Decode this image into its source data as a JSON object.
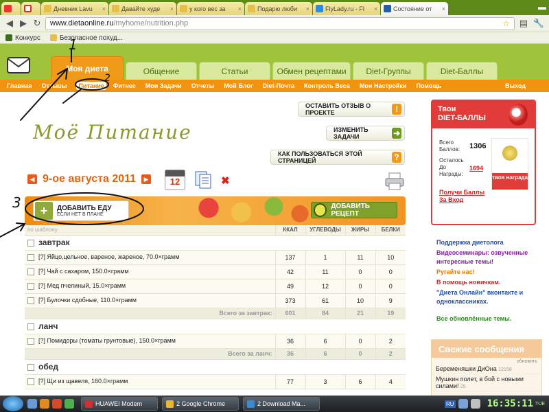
{
  "browser": {
    "tabs": [
      {
        "label": "",
        "color": "#e33"
      },
      {
        "label": "",
        "color": "#c33"
      },
      {
        "label": "Дневник Lavu",
        "color": "#e4c04a"
      },
      {
        "label": "Давайте худе",
        "color": "#e4c04a"
      },
      {
        "label": "у кого вес за",
        "color": "#e4c04a"
      },
      {
        "label": "Подарю люби",
        "color": "#e4c04a"
      },
      {
        "label": "FlyLady.ru - Fl",
        "color": "#2a8de0"
      },
      {
        "label": "Состояние от",
        "color": "#1f5fb0"
      }
    ],
    "url_host": "www.dietaonline.ru",
    "url_path": "/myhome/nutrition.php",
    "bookmarks": [
      "Конкурс",
      "Безопасное похуд..."
    ]
  },
  "site": {
    "main_tabs": [
      "Моя диета",
      "Общение",
      "Статьи",
      "Обмен рецептами",
      "Diet-Группы",
      "Diet-Баллы"
    ],
    "subnav": [
      "Главная",
      "Отзывы",
      "Питание",
      "Фитнес",
      "Мои Задачи",
      "Отчеты",
      "Мой Блог",
      "Diet-Почта",
      "Контроль Веса",
      "Мои Настройки",
      "Помощь"
    ],
    "exit": "Выход",
    "page_title": "Моё Питание",
    "btn_feedback": "ОСТАВИТЬ ОТЗЫВ О ПРОЕКТЕ",
    "btn_tasks": "ИЗМЕНИТЬ ЗАДАЧИ",
    "btn_howto": "КАК ПОЛЬЗОВАТЬСЯ ЭТОЙ СТРАНИЦЕЙ",
    "date": "9-ое августа 2011",
    "cal_num": "12",
    "add_food_1": "ДОБАВИТЬ ЕДУ",
    "add_food_2": "ЕСЛИ НЕТ В ПЛАНЕ",
    "add_recipe": "ДОБАВИТЬ РЕЦЕПТ",
    "col_hidden": "по шаблону",
    "columns": [
      "ККАЛ",
      "УГЛЕВОДЫ",
      "ЖИРЫ",
      "БЕЛКИ"
    ],
    "meals": [
      {
        "name": "завтрак",
        "items": [
          {
            "label": "[?] Яйцо,цельное, вареное, жареное, 70.0×грамм",
            "v": [
              "137",
              "1",
              "11",
              "10"
            ]
          },
          {
            "label": "[?] Чай с сахаром, 150.0×грамм",
            "v": [
              "42",
              "11",
              "0",
              "0"
            ]
          },
          {
            "label": "[?] Мед пчелиный, 15.0×грамм",
            "v": [
              "49",
              "12",
              "0",
              "0"
            ]
          },
          {
            "label": "[?] Булочки сдобные, 110.0×грамм",
            "v": [
              "373",
              "61",
              "10",
              "9"
            ]
          }
        ],
        "total_label": "Всего за завтрак:",
        "total": [
          "601",
          "84",
          "21",
          "19"
        ]
      },
      {
        "name": "ланч",
        "items": [
          {
            "label": "[?] Помидоры (томаты грунтовые), 150.0×грамм",
            "v": [
              "36",
              "6",
              "0",
              "2"
            ]
          }
        ],
        "total_label": "Всего за ланч:",
        "total": [
          "36",
          "6",
          "0",
          "2"
        ]
      },
      {
        "name": "обед",
        "items": [
          {
            "label": "[?] Щи из щавеля, 160.0×грамм",
            "v": [
              "77",
              "3",
              "6",
              "4"
            ]
          }
        ]
      }
    ]
  },
  "sidebar": {
    "head_1": "Твои",
    "head_2": "DIET-БАЛЛЫ",
    "total_label": "Всего Баллов:",
    "total_value": "1306",
    "left_label": "Осталось До Награды:",
    "left_value": "1694",
    "award": "твоя награда",
    "get_points": "Получи Баллы За Вход",
    "links": [
      {
        "text": "Поддержка диетолога",
        "color": "#1c4fa8"
      },
      {
        "text": "Видеосеминары: озвученные интересные темы!",
        "color": "#8a1fa0"
      },
      {
        "text": "Ругайте нас!",
        "color": "#e07a00"
      },
      {
        "text": "В помощь новичкам.",
        "color": "#d02020"
      },
      {
        "text": "\"Диета Онлайн\" вконтакте и одноклассниках.",
        "color": "#1c4fa8"
      },
      {
        "text": "Все обновлённые темы.",
        "color": "#2a8a1a"
      }
    ],
    "fresh_title": "Свежие сообщения",
    "fresh_sub": "обновить",
    "fresh_items": [
      {
        "t": "Беременяшки ДиОна",
        "c": "12158"
      },
      {
        "t": "Мушкин полет, в бой с новыми силами!",
        "c": "25"
      }
    ]
  },
  "taskbar": {
    "items": [
      "HUAWEI Modem",
      "2 Google Chrome",
      "2 Download Ma..."
    ],
    "lang": "RU",
    "clock": "16:35:11",
    "day": "TUE"
  },
  "annotations": [
    "1",
    "2",
    "3"
  ]
}
